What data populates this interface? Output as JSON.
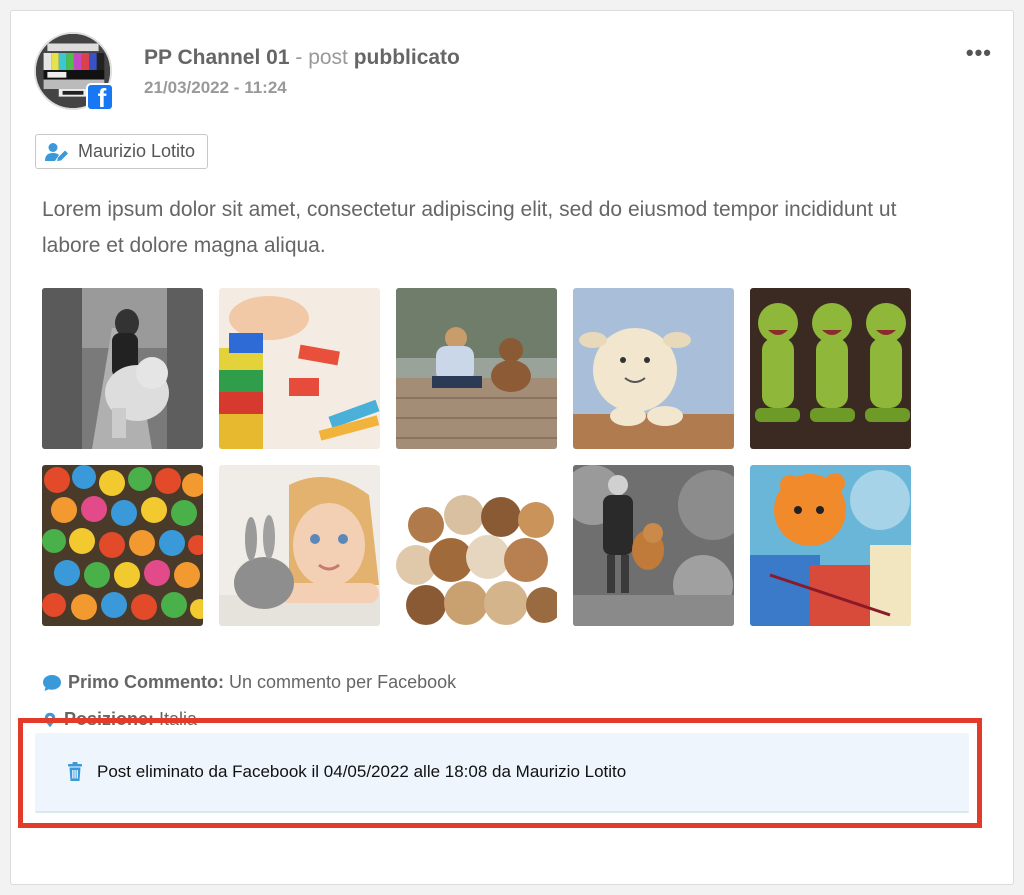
{
  "post": {
    "channel_name": "PP Channel 01",
    "separator": " - ",
    "status_word": "post ",
    "status": "pubblicato",
    "date": "21/03/2022 - 11:24",
    "menu_icon": "more-horizontal-icon",
    "network_icon": "facebook-icon",
    "network_letter": "f",
    "author": "Maurizio Lotito",
    "text": "Lorem ipsum dolor sit amet, consectetur adipiscing elit, sed do eiusmod tempor incididunt ut labore et dolore magna aliqua."
  },
  "meta": {
    "first_comment_label": "Primo Commento:",
    "first_comment_value": " Un commento per Facebook",
    "position_label": "Posizione:",
    "position_value": " Italia"
  },
  "notice": {
    "text": "Post eliminato da Facebook il 04/05/2022 alle 18:08 da Maurizio Lotito",
    "icon": "trash-icon"
  },
  "colors": {
    "accent_blue": "#3a9ad9",
    "facebook_blue": "#1877f2",
    "highlight_red": "#e23b2a",
    "notice_bg": "#eef5fc"
  }
}
